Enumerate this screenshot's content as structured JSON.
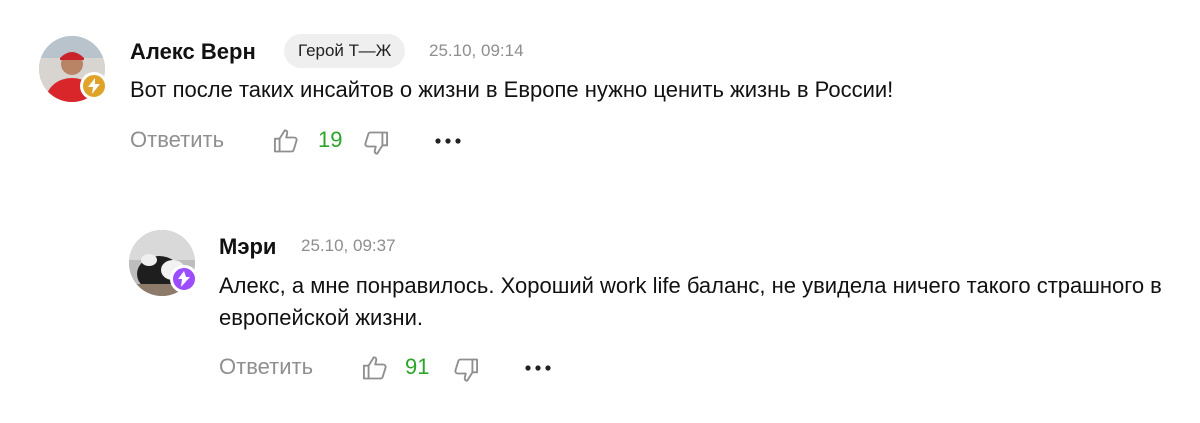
{
  "comments": [
    {
      "author": "Алекс Верн",
      "tag": "Герой Т—Ж",
      "time": "25.10, 09:14",
      "text": "Вот после таких инсайтов о жизни в Европе нужно ценить жизнь в России!",
      "reply_label": "Ответить",
      "likes": "19",
      "badge_color": "#e0a32a",
      "icons": [
        "thumbs-up-icon",
        "thumbs-down-icon",
        "more-dots-icon"
      ]
    },
    {
      "author": "Мэри",
      "time": "25.10, 09:37",
      "text": "Алекс, а мне понравилось. Хороший work life баланс, не увидела ничего такого страшного в европейской жизни.",
      "reply_label": "Ответить",
      "likes": "91",
      "badge_color": "#9b4dff",
      "icons": [
        "thumbs-up-icon",
        "thumbs-down-icon",
        "more-dots-icon"
      ]
    }
  ],
  "colors": {
    "likes": "#2aa52a",
    "secondary_text": "#8f8f8f",
    "tag_background": "#efefef"
  }
}
